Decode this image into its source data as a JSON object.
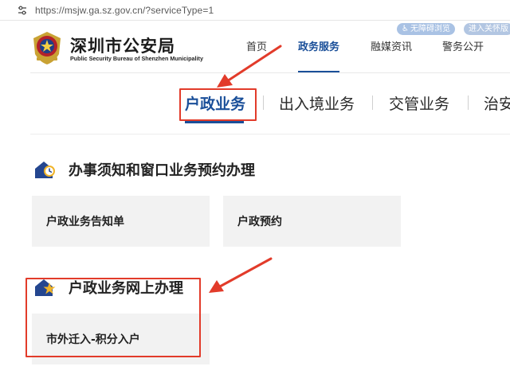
{
  "browser": {
    "url": "https://msjw.ga.sz.gov.cn/?serviceType=1"
  },
  "header": {
    "title": "深圳市公安局",
    "subtitle": "Public Security Bureau of Shenzhen Municipality",
    "accessibility_label": "无障碍浏览",
    "elder_label": "进入关怀版",
    "nav": [
      {
        "label": "首页"
      },
      {
        "label": "政务服务"
      },
      {
        "label": "融媒资讯"
      },
      {
        "label": "警务公开"
      }
    ]
  },
  "sub_tabs": [
    {
      "label": "户政业务"
    },
    {
      "label": "出入境业务"
    },
    {
      "label": "交管业务"
    },
    {
      "label": "治安"
    }
  ],
  "sections": [
    {
      "title": "办事须知和窗口业务预约办理",
      "icon": "clock-building-icon",
      "cards": [
        {
          "label": "户政业务告知单"
        },
        {
          "label": "户政预约"
        }
      ]
    },
    {
      "title": "户政业务网上办理",
      "icon": "star-building-icon",
      "cards": [
        {
          "label": "市外迁入-积分入户"
        }
      ]
    }
  ],
  "colors": {
    "accent": "#1a4f99",
    "annotation": "#e23b2a",
    "card_bg": "#f2f2f2"
  }
}
